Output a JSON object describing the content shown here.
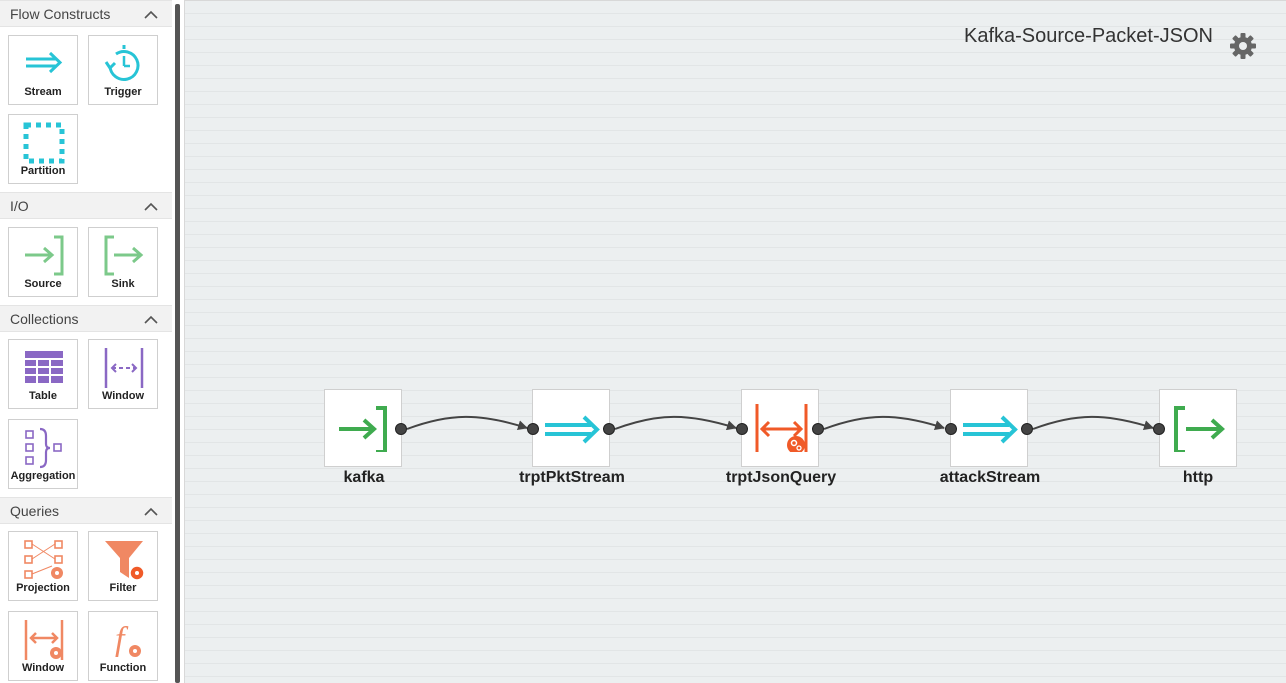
{
  "palette": {
    "sections": [
      {
        "title": "Flow Constructs",
        "items": [
          {
            "label": "Stream",
            "icon": "stream-icon"
          },
          {
            "label": "Trigger",
            "icon": "trigger-icon"
          },
          {
            "label": "Partition",
            "icon": "partition-icon"
          }
        ]
      },
      {
        "title": "I/O",
        "items": [
          {
            "label": "Source",
            "icon": "source-icon"
          },
          {
            "label": "Sink",
            "icon": "sink-icon"
          }
        ]
      },
      {
        "title": "Collections",
        "items": [
          {
            "label": "Table",
            "icon": "table-icon"
          },
          {
            "label": "Window",
            "icon": "window-icon"
          },
          {
            "label": "Aggregation",
            "icon": "aggregation-icon"
          }
        ]
      },
      {
        "title": "Queries",
        "items": [
          {
            "label": "Projection",
            "icon": "projection-icon"
          },
          {
            "label": "Filter",
            "icon": "filter-icon"
          },
          {
            "label": "Window",
            "icon": "window-query-icon"
          },
          {
            "label": "Function",
            "icon": "function-icon"
          }
        ]
      }
    ]
  },
  "canvas": {
    "title": "Kafka-Source-Packet-JSON",
    "settings_icon": "gear-icon",
    "nodes": [
      {
        "label": "kafka",
        "icon": "source-icon"
      },
      {
        "label": "trptPktStream",
        "icon": "stream-icon"
      },
      {
        "label": "trptJsonQuery",
        "icon": "window-query-icon"
      },
      {
        "label": "attackStream",
        "icon": "stream-icon"
      },
      {
        "label": "http",
        "icon": "sink-icon"
      }
    ]
  },
  "colors": {
    "stream": "#27c4d6",
    "io_light": "#7cc98a",
    "io_dark": "#3fab4f",
    "collection": "#8a68c4",
    "query": "#f08863",
    "query_dark": "#f05a28"
  }
}
